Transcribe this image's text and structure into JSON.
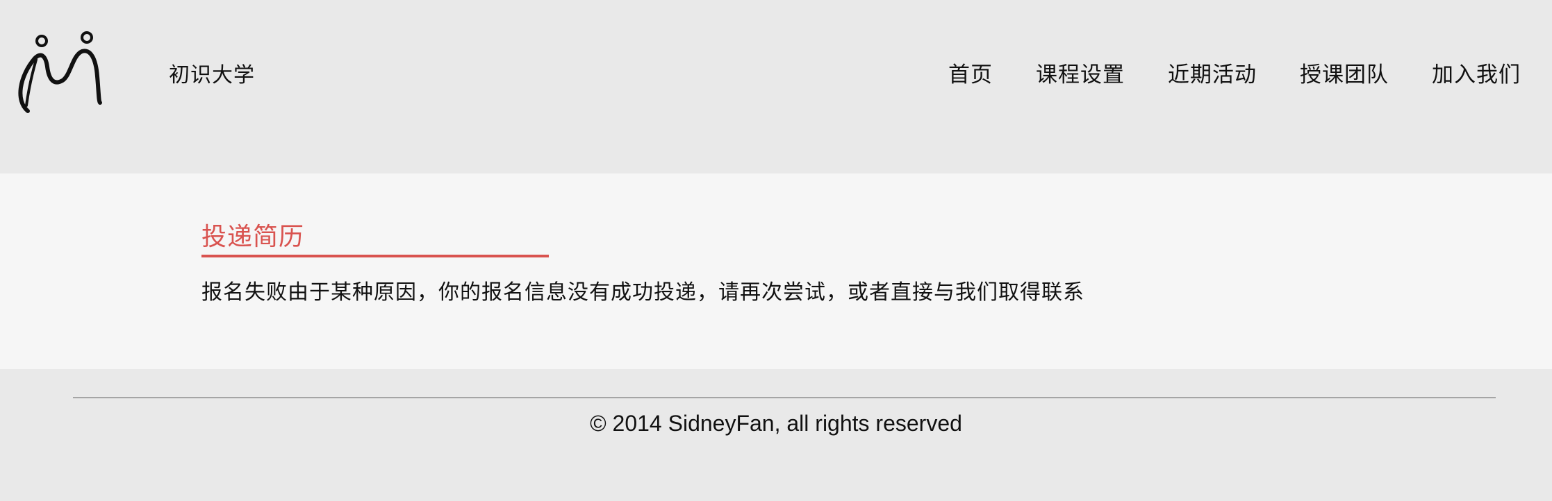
{
  "header": {
    "brand": "初识大学",
    "logo_icon": "stick-figures-logo",
    "nav": [
      {
        "label": "首页"
      },
      {
        "label": "课程设置"
      },
      {
        "label": "近期活动"
      },
      {
        "label": "授课团队"
      },
      {
        "label": "加入我们"
      }
    ]
  },
  "main": {
    "title": "投递简历",
    "message": "报名失败由于某种原因，你的报名信息没有成功投递，请再次尝试，或者直接与我们取得联系"
  },
  "footer": {
    "copyright": "© 2014 SidneyFan, all rights reserved"
  },
  "colors": {
    "accent": "#d9534f",
    "header_bg": "#e9e9e9",
    "content_bg": "#f6f6f6"
  }
}
